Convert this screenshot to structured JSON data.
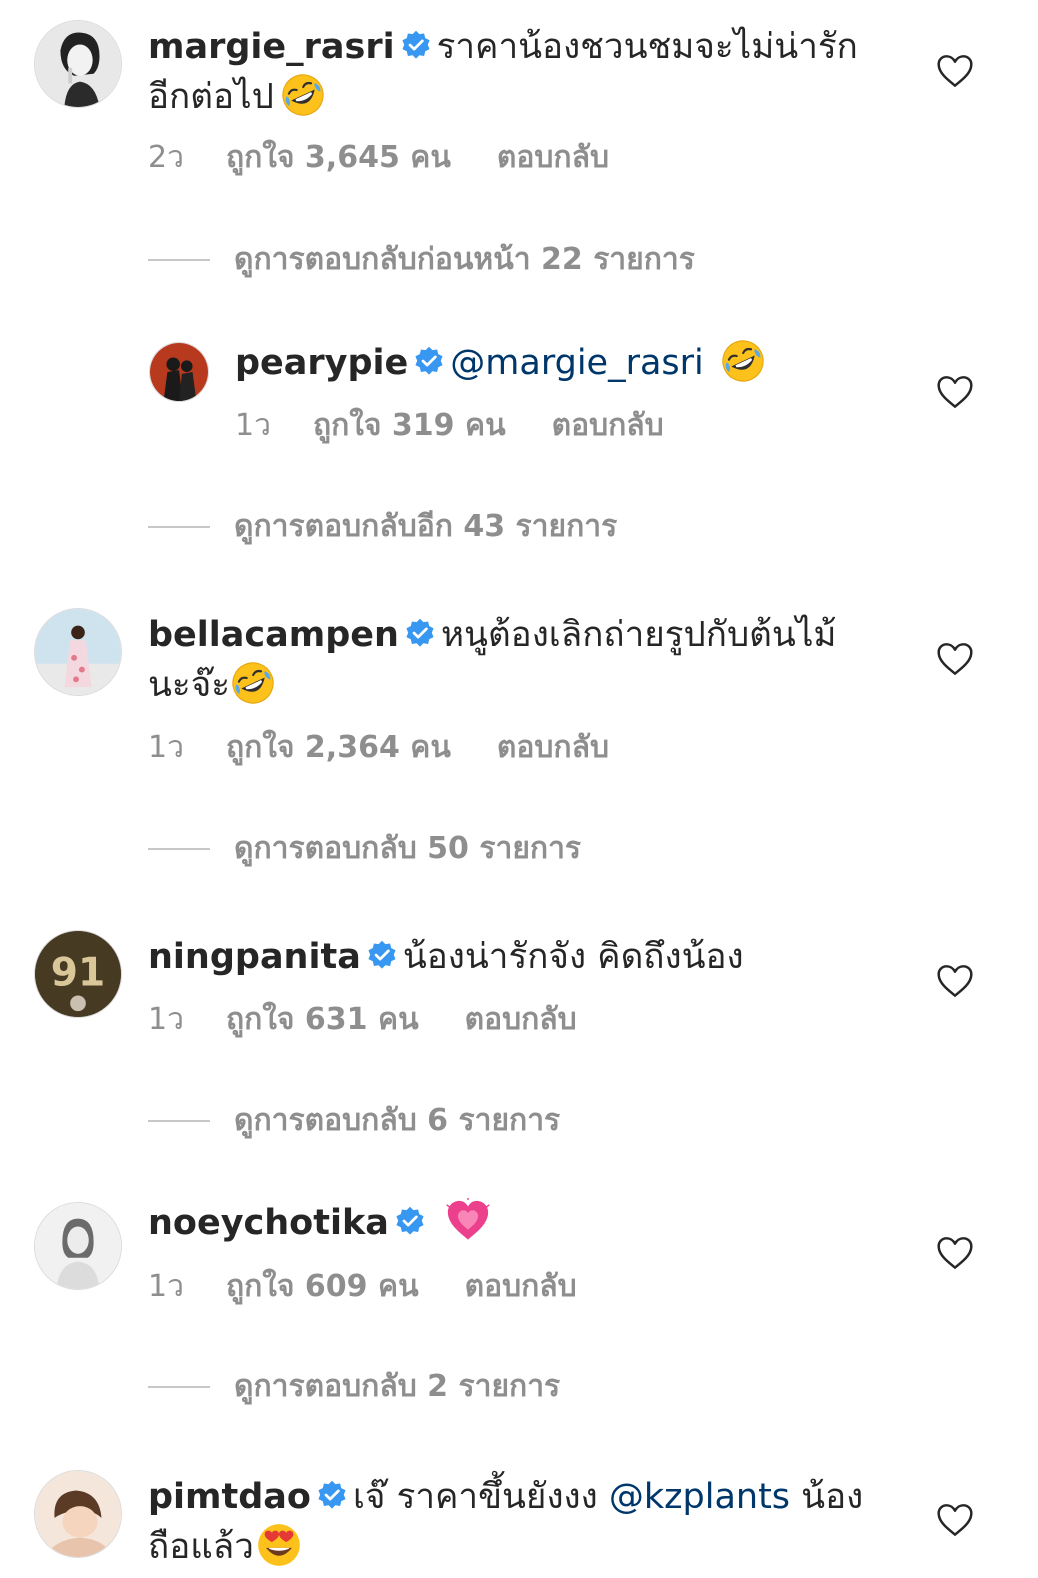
{
  "comments": [
    {
      "username": "margie_rasri",
      "text": "ราคาน้องชวนชมจะไม่น่ารัก",
      "text2": "อีกต่อไป",
      "emoji": "rofl-emoji",
      "time": "2ว",
      "likes": "ถูกใจ 3,645 คน",
      "reply_label": "ตอบกลับ",
      "view_replies": "ดูการตอบกลับก่อนหน้า 22 รายการ"
    },
    {
      "username": "pearypie",
      "mention": "@margie_rasri",
      "emoji": "rofl-emoji",
      "time": "1ว",
      "likes": "ถูกใจ 319 คน",
      "reply_label": "ตอบกลับ",
      "view_replies": "ดูการตอบกลับอีก 43 รายการ"
    },
    {
      "username": "bellacampen",
      "text": "หนูต้องเลิกถ่ายรูปกับต้นไม้",
      "text2": "นะจ๊ะ",
      "emoji": "rofl-emoji",
      "time": "1ว",
      "likes": "ถูกใจ 2,364 คน",
      "reply_label": "ตอบกลับ",
      "view_replies": "ดูการตอบกลับ 50 รายการ"
    },
    {
      "username": "ningpanita",
      "text": "น้องน่ารักจัง คิดถึงน้อง",
      "time": "1ว",
      "likes": "ถูกใจ 631 คน",
      "reply_label": "ตอบกลับ",
      "view_replies": "ดูการตอบกลับ 6 รายการ"
    },
    {
      "username": "noeychotika",
      "emoji": "pink-heart-emoji",
      "time": "1ว",
      "likes": "ถูกใจ 609 คน",
      "reply_label": "ตอบกลับ",
      "view_replies": "ดูการตอบกลับ 2 รายการ"
    },
    {
      "username": "pimtdao",
      "text": "เจ๊ ราคาขึ้นยังงง",
      "mention": "@kzplants",
      "text_after": "น้อง",
      "text2": "ถือแล้ว",
      "emoji": "heart-eyes-emoji"
    }
  ],
  "colors": {
    "primary_text": "#262626",
    "secondary_text": "#8e8e8e",
    "mention": "#00376b",
    "verified_badge": "#3897f0",
    "divider": "#c7c7c7"
  },
  "icons": {
    "verified": "verified-badge-icon",
    "like": "heart-outline-icon"
  }
}
